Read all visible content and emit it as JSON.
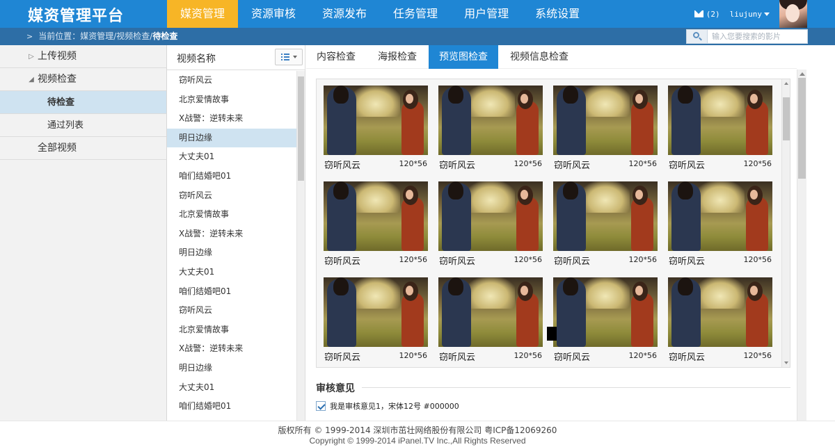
{
  "app": {
    "title": "媒资管理平台"
  },
  "nav": [
    {
      "label": "媒资管理",
      "active": true
    },
    {
      "label": "资源审核",
      "active": false
    },
    {
      "label": "资源发布",
      "active": false
    },
    {
      "label": "任务管理",
      "active": false
    },
    {
      "label": "用户管理",
      "active": false
    },
    {
      "label": "系统设置",
      "active": false
    }
  ],
  "user": {
    "mail_count": "(2)",
    "username": "liujuny"
  },
  "breadcrumb": {
    "prefix": "当前位置：媒资管理/视频检查/",
    "current": "待检查"
  },
  "search": {
    "placeholder": "输入您要搜索的影片"
  },
  "sidebar": {
    "items": [
      {
        "label": "上传视频",
        "arrow": "▷"
      },
      {
        "label": "视频检查",
        "arrow": "◢"
      },
      {
        "label": "待检查",
        "active": true
      },
      {
        "label": "通过列表"
      },
      {
        "label": "全部视频"
      }
    ]
  },
  "video_list": {
    "header": "视频名称",
    "items": [
      "窃听风云",
      "北京爱情故事",
      "X战警：逆转未来",
      "明日边缘",
      "大丈夫01",
      "咱们结婚吧01",
      "窃听风云",
      "北京爱情故事",
      "X战警：逆转未来",
      "明日边缘",
      "大丈夫01",
      "咱们结婚吧01",
      "窃听风云",
      "北京爱情故事",
      "X战警：逆转未来",
      "明日边缘",
      "大丈夫01",
      "咱们结婚吧01"
    ],
    "active_index": 3
  },
  "tabs": [
    {
      "label": "内容检查",
      "active": false
    },
    {
      "label": "海报检查",
      "active": false
    },
    {
      "label": "预览图检查",
      "active": true
    },
    {
      "label": "视频信息检查",
      "active": false
    }
  ],
  "previews": [
    {
      "title": "窃听风云",
      "size": "120*56"
    },
    {
      "title": "窃听风云",
      "size": "120*56"
    },
    {
      "title": "窃听风云",
      "size": "120*56"
    },
    {
      "title": "窃听风云",
      "size": "120*56"
    },
    {
      "title": "窃听风云",
      "size": "120*56"
    },
    {
      "title": "窃听风云",
      "size": "120*56"
    },
    {
      "title": "窃听风云",
      "size": "120*56"
    },
    {
      "title": "窃听风云",
      "size": "120*56"
    },
    {
      "title": "窃听风云",
      "size": "120*56"
    },
    {
      "title": "窃听风云",
      "size": "120*56"
    },
    {
      "title": "窃听风云",
      "size": "120*56"
    },
    {
      "title": "窃听风云",
      "size": "120*56"
    }
  ],
  "review": {
    "title": "审核意见",
    "opinions": [
      {
        "label": "我是审核意见1，宋体12号 #000000",
        "checked": true
      }
    ]
  },
  "footer": {
    "line1": "版权所有 © 1999-2014 深圳市茁壮网络股份有限公司    粤ICP备12069260",
    "line2": "Copyright © 1999-2014 iPanel.TV Inc.,All Rights Reserved"
  },
  "colors": {
    "primary": "#1f86d4",
    "nav_active": "#f7b526",
    "crumb_bar": "#2d6ea6",
    "selected_bg": "#cfe3f1"
  },
  "icons": {
    "mail": "mail-icon",
    "search": "search-icon",
    "list_view": "list-view-icon",
    "checkbox": "checkbox-icon"
  }
}
